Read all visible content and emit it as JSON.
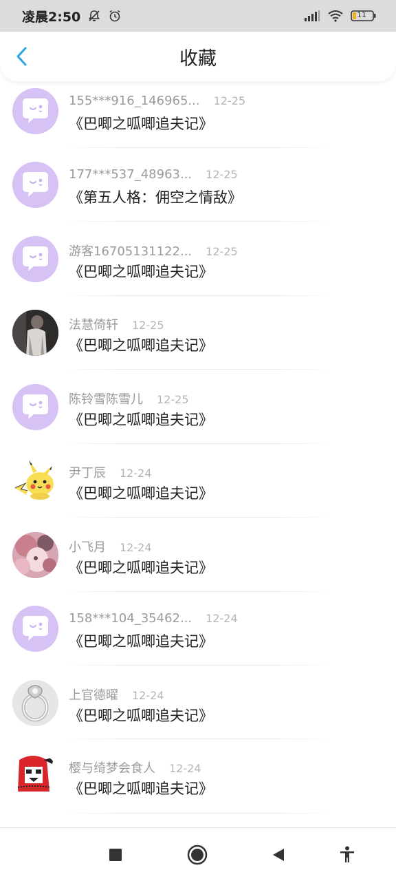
{
  "status_bar": {
    "time": "凌晨2:50",
    "battery": "11"
  },
  "header": {
    "title": "收藏"
  },
  "items": [
    {
      "name": "155***916_146965...",
      "date": "12-25",
      "title": "《巴唧之呱唧追夫记》",
      "avatar": "default"
    },
    {
      "name": "177***537_48963...",
      "date": "12-25",
      "title": "《第五人格：佣空之情敌》",
      "avatar": "default"
    },
    {
      "name": "游客16705131122...",
      "date": "12-25",
      "title": "《巴唧之呱唧追夫记》",
      "avatar": "default"
    },
    {
      "name": "法慧倚轩",
      "date": "12-25",
      "title": "《巴唧之呱唧追夫记》",
      "avatar": "photo-person"
    },
    {
      "name": "陈铃雪陈雪儿",
      "date": "12-25",
      "title": "《巴唧之呱唧追夫记》",
      "avatar": "default"
    },
    {
      "name": "尹丁辰",
      "date": "12-24",
      "title": "《巴唧之呱唧追夫记》",
      "avatar": "pikachu"
    },
    {
      "name": "小飞月",
      "date": "12-24",
      "title": "《巴唧之呱唧追夫记》",
      "avatar": "photo-pink"
    },
    {
      "name": "158***104_35462...",
      "date": "12-24",
      "title": "《巴唧之呱唧追夫记》",
      "avatar": "default"
    },
    {
      "name": "上官德曜",
      "date": "12-24",
      "title": "《巴唧之呱唧追夫记》",
      "avatar": "photo-ring"
    },
    {
      "name": "樱与绮梦会食人",
      "date": "12-24",
      "title": "《巴唧之呱唧追夫记》",
      "avatar": "anime-red"
    }
  ],
  "colors": {
    "accent": "#2aa7e0",
    "default_avatar": "#d6c2f5",
    "status_bar": "#dcdcdc"
  }
}
